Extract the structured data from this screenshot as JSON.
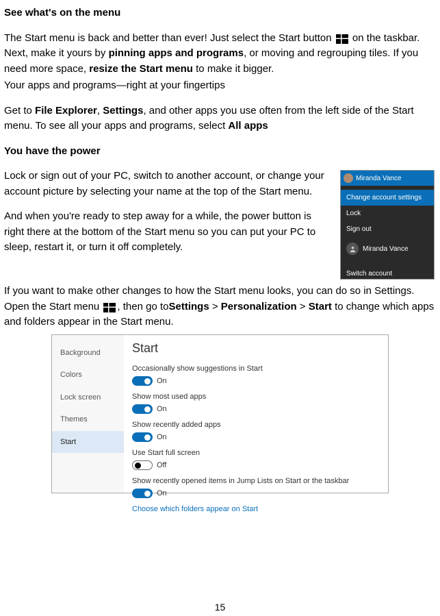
{
  "heading1": "See what's on the menu",
  "p1_a": "The Start menu is back and better than ever! Just select the Start button ",
  "p1_b": " on the taskbar. Next, make it yours by ",
  "p1_link1": "pinning apps and programs",
  "p1_c": ", or moving and regrouping tiles. If you need more space, ",
  "p1_link2": "resize the Start menu",
  "p1_d": " to make it bigger.",
  "p2": "Your apps and programs—right at your fingertips",
  "p3_a": "Get to ",
  "p3_b1": "File Explorer",
  "p3_c": ", ",
  "p3_b2": "Settings",
  "p3_d": ", and other apps you use often from the left side of the Start menu. To see all your apps and programs, select ",
  "p3_b3": "All apps",
  "heading2": "You have the power",
  "p4": "Lock or sign out of your PC, switch to another account, or change your account picture by selecting your name at the top of the Start menu.",
  "p5": "And when you're ready to step away for a while, the power button is right there at the bottom of the Start menu so you can put your PC to sleep, restart it, or turn it off completely.",
  "p6_a": "If you want to make other changes to how the Start menu looks, you can do so in Settings. Open the Start menu ",
  "p6_b": ", then go to",
  "p6_c1": "Settings",
  "p6_gt1": " > ",
  "p6_c2": "Personalization",
  "p6_gt2": " > ",
  "p6_c3": "Start",
  "p6_d": " to change which apps and folders appear in the Start menu.",
  "acct": {
    "user": "Miranda Vance",
    "items": [
      "Change account settings",
      "Lock",
      "Sign out"
    ],
    "user2": "Miranda Vance",
    "switch": "Switch account"
  },
  "settings": {
    "nav": [
      "Background",
      "Colors",
      "Lock screen",
      "Themes",
      "Start"
    ],
    "title": "Start",
    "opts": [
      {
        "label": "Occasionally show suggestions in Start",
        "state": "On",
        "on": true
      },
      {
        "label": "Show most used apps",
        "state": "On",
        "on": true
      },
      {
        "label": "Show recently added apps",
        "state": "On",
        "on": true
      },
      {
        "label": "Use Start full screen",
        "state": "Off",
        "on": false
      },
      {
        "label": "Show recently opened items in Jump Lists on Start or the taskbar",
        "state": "On",
        "on": true
      }
    ],
    "link": "Choose which folders appear on Start"
  },
  "page_number": "15"
}
